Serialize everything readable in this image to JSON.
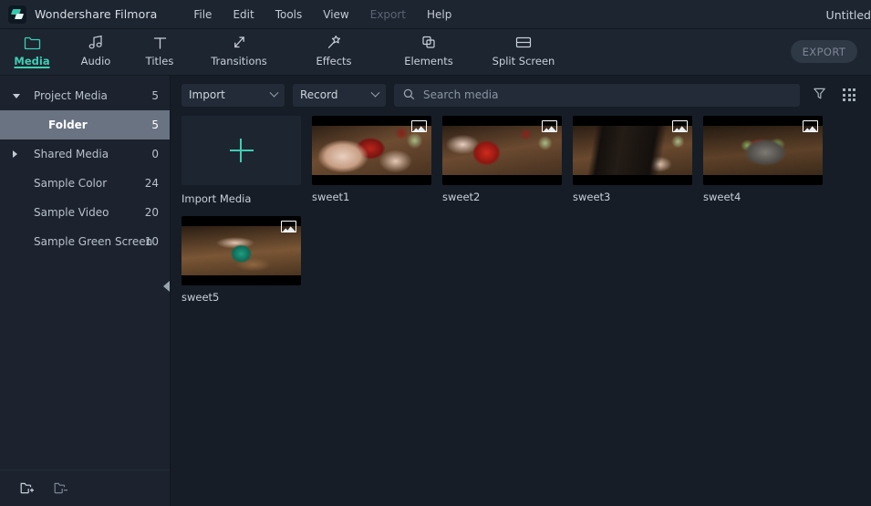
{
  "titlebar": {
    "app_name": "Wondershare Filmora",
    "logo_icon": "filmora-logo-icon",
    "document_title": "Untitled",
    "menu": [
      {
        "label": "File",
        "disabled": false
      },
      {
        "label": "Edit",
        "disabled": false
      },
      {
        "label": "Tools",
        "disabled": false
      },
      {
        "label": "View",
        "disabled": false
      },
      {
        "label": "Export",
        "disabled": true
      },
      {
        "label": "Help",
        "disabled": false
      }
    ]
  },
  "toolbar": {
    "tabs": [
      {
        "label": "Media",
        "icon": "folder-icon",
        "active": true
      },
      {
        "label": "Audio",
        "icon": "music-note-icon",
        "active": false
      },
      {
        "label": "Titles",
        "icon": "text-t-icon",
        "active": false
      },
      {
        "label": "Transitions",
        "icon": "transition-arrows-icon",
        "active": false
      },
      {
        "label": "Effects",
        "icon": "magic-star-icon",
        "active": false
      },
      {
        "label": "Elements",
        "icon": "stacked-squares-icon",
        "active": false
      },
      {
        "label": "Split Screen",
        "icon": "split-screen-icon",
        "active": false
      }
    ],
    "export_button": "EXPORT",
    "accent_color": "#3ecfb2"
  },
  "sidebar": {
    "items": [
      {
        "label": "Project Media",
        "count": "5",
        "caret": "down",
        "indent": false,
        "selected": false
      },
      {
        "label": "Folder",
        "count": "5",
        "caret": "none",
        "indent": true,
        "selected": true
      },
      {
        "label": "Shared Media",
        "count": "0",
        "caret": "right",
        "indent": false,
        "selected": false
      },
      {
        "label": "Sample Color",
        "count": "24",
        "caret": "none",
        "indent": false,
        "selected": false
      },
      {
        "label": "Sample Video",
        "count": "20",
        "caret": "none",
        "indent": false,
        "selected": false
      },
      {
        "label": "Sample Green Screen",
        "count": "10",
        "caret": "none",
        "indent": false,
        "selected": false
      }
    ],
    "bottom_buttons": [
      {
        "icon": "new-folder-icon"
      },
      {
        "icon": "remove-folder-icon"
      }
    ],
    "collapse_icon": "collapse-left-icon"
  },
  "mediabar": {
    "import_label": "Import",
    "record_label": "Record",
    "search_placeholder": "Search media",
    "search_value": "",
    "search_icon": "search-icon",
    "filter_icon": "filter-funnel-icon",
    "grid_view_icon": "grid-view-icon"
  },
  "media": {
    "import_tile": {
      "label": "Import Media",
      "icon": "plus-icon"
    },
    "items": [
      {
        "name": "sweet1",
        "badge_icon": "image-badge-icon"
      },
      {
        "name": "sweet2",
        "badge_icon": "image-badge-icon"
      },
      {
        "name": "sweet3",
        "badge_icon": "image-badge-icon"
      },
      {
        "name": "sweet4",
        "badge_icon": "image-badge-icon"
      },
      {
        "name": "sweet5",
        "badge_icon": "image-badge-icon"
      }
    ]
  }
}
